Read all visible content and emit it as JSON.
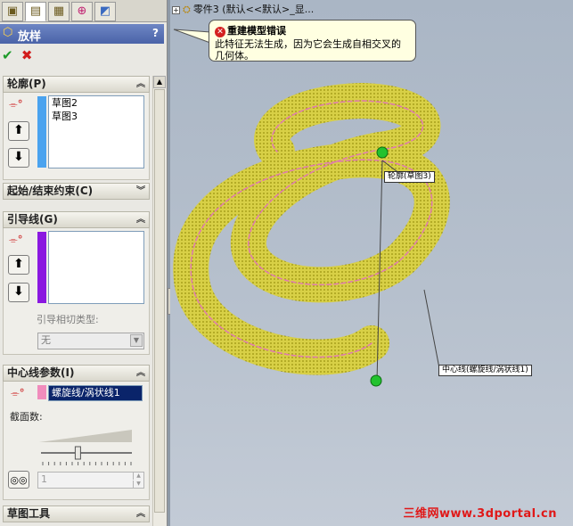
{
  "left_panel": {
    "tabs": [
      "feature-manager-icon",
      "property-manager-icon",
      "configuration-manager-icon",
      "dimxpert-icon",
      "display-manager-icon"
    ],
    "title": "放样",
    "help_label": "?",
    "ok_label": "✔",
    "cancel_label": "✖",
    "profiles": {
      "header": "轮廓(P)",
      "items": [
        "草图2",
        "草图3"
      ],
      "color": "#4aa3ef"
    },
    "start_end": {
      "header": "起始/结束约束(C)"
    },
    "guides": {
      "header": "引导线(G)",
      "color": "#8a18e0",
      "tangency_label": "引导相切类型:",
      "tangency_value": "无"
    },
    "centerline": {
      "header": "中心线参数(I)",
      "color": "#f08cbc",
      "value": "螺旋线/涡状线1",
      "sections_label": "截面数:",
      "slider_level": 0.4,
      "spin_value": "1"
    },
    "sketch_tools": {
      "header": "草图工具"
    }
  },
  "graphics": {
    "tree_item": "零件3  (默认<<默认>_显...",
    "error": {
      "title": "重建模型错误",
      "message": "此特征无法生成，因为它会生成自相交叉的几何体。"
    },
    "callouts": {
      "profile": "轮廓(草图3)",
      "centerline": "中心线(螺旋线/涡状线1)"
    },
    "watermark": "三维网www.3dportal.cn",
    "colors": {
      "tube": "#c8c4a0",
      "outline": "#f2e60a",
      "handle": "#22c22e"
    }
  }
}
